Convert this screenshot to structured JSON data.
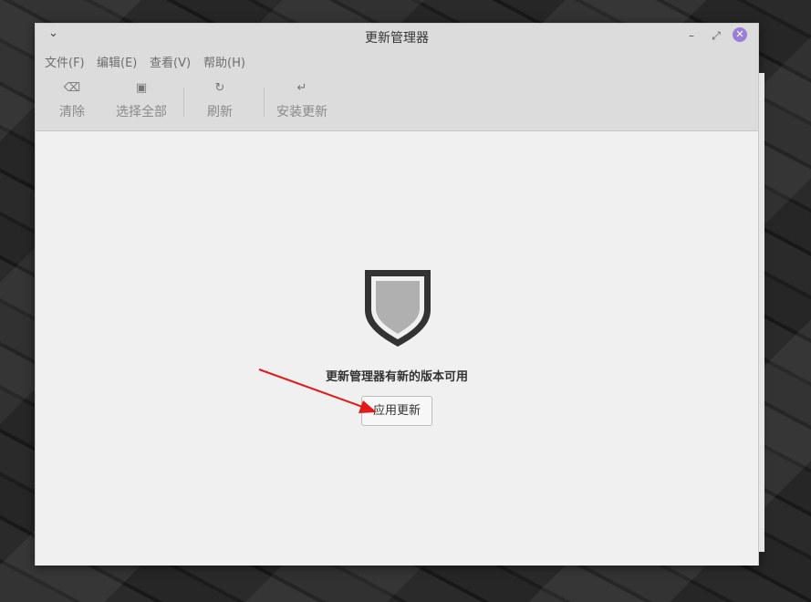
{
  "window": {
    "title": "更新管理器",
    "menu": [
      "文件(F)",
      "编辑(E)",
      "查看(V)",
      "帮助(H)"
    ]
  },
  "toolbar": {
    "clear_label": "清除",
    "select_all_label": "选择全部",
    "refresh_label": "刷新",
    "install_label": "安装更新"
  },
  "main": {
    "message": "更新管理器有新的版本可用",
    "apply_button_label": "应用更新"
  },
  "colors": {
    "accent": "#9b7fd6",
    "annotation_arrow": "#e01b1b",
    "shield_fill": "#b0b0b0",
    "shield_outline": "#333333"
  }
}
